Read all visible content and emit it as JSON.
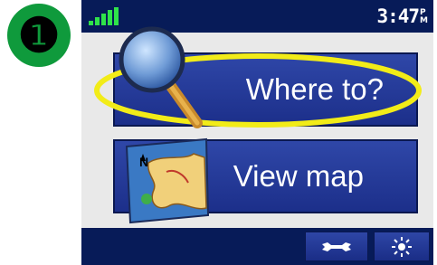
{
  "step": {
    "number": "❶"
  },
  "status": {
    "time": "3:47",
    "ampm_top": "P",
    "ampm_bottom": "M",
    "signal_icon": "signal-bars-icon"
  },
  "menu": {
    "where_to_label": "Where to?",
    "view_map_label": "View map"
  },
  "toolbar": {
    "tools_icon": "wrench-icon",
    "brightness_icon": "sun-icon"
  },
  "colors": {
    "screen_dark_blue": "#071b58",
    "button_blue": "#2f47a8",
    "highlight_yellow": "#f2ec18",
    "step_green": "#0f9a3c",
    "signal_green": "#2fe34a"
  }
}
